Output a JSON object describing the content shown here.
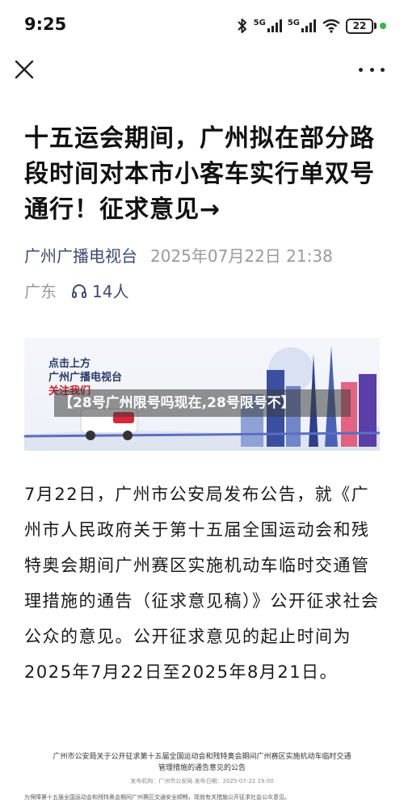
{
  "status_bar": {
    "time": "9:25",
    "signal1_label": "5G",
    "signal2_label": "5G",
    "battery_level": "22",
    "colors": {
      "charge_dot": "#39b54a"
    }
  },
  "nav": {
    "close_icon": "close-icon",
    "more_icon": "more-icon"
  },
  "article": {
    "title": "十五运会期间，广州拟在部分路段时间对本市小客车实行单双号通行！征求意见→",
    "source": "广州广播电视台",
    "publish_time": "2025年07月22日 21:38",
    "location": "广东",
    "listeners": "14人",
    "colors": {
      "source": "#3f4a73",
      "meta": "#9a9a9a"
    }
  },
  "banner": {
    "line1": "点击上方",
    "line2": "广州广播电视台",
    "line3": "关注我们"
  },
  "overlay_caption": "【28号广州限号吗现在,28号限号不】",
  "body": {
    "paragraph": "7月22日，广州市公安局发布公告，就《广州市人民政府关于第十五届全国运动会和残特奥会期间广州赛区实施机动车临时交通管理措施的通告（征求意见稿）》公开征求社会公众的意见。公开征求意见的起止时间为2025年7月22日至2025年8月21日。"
  },
  "document": {
    "title_line1": "广州市公安局关于公开征求第十五届全国运动会和残特奥会期间广州赛区实施机动车临时交通",
    "title_line2": "管理措施的通告意见的公告",
    "sub": "发布机构：广州市公安局   发布日期：2025-07-22 19:00",
    "first_line": "为保障第十五届全国运动会和残特奥会期间广州赛区交通安全顺畅，现就有关措施公开征求社会公众意见。"
  }
}
